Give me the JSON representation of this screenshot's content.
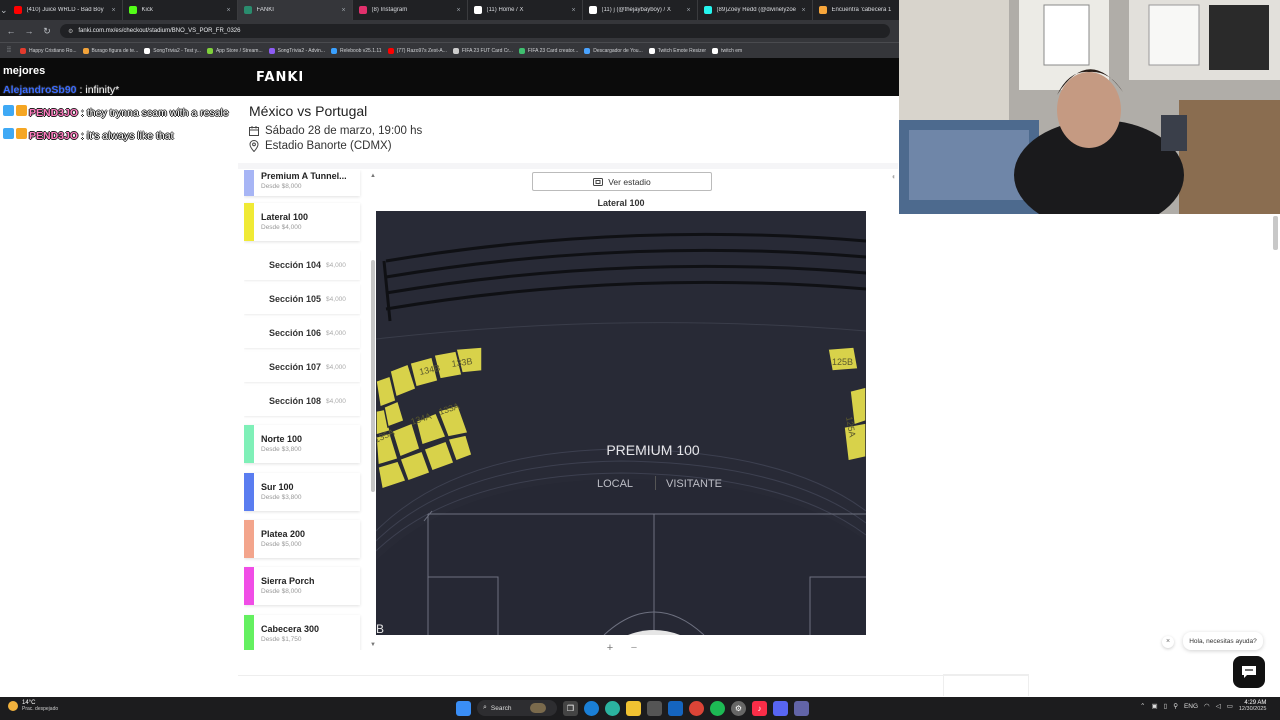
{
  "browser": {
    "tabs": [
      {
        "label": "(410) Juice WRLD - Bad Boy",
        "favicon_color": "#ff0000"
      },
      {
        "label": "Kick",
        "favicon_color": "#53fc18"
      },
      {
        "label": "FANKI",
        "favicon_color": "#2a8c6e"
      },
      {
        "label": "(8) Instagram",
        "favicon_color": "#e1306c"
      },
      {
        "label": "(11) Home / X",
        "favicon_color": "#ffffff"
      },
      {
        "label": "(11) j (@thejaybayboy) / X",
        "favicon_color": "#ffffff"
      },
      {
        "label": "(89)Zoey Redd (@divinelyzoey)",
        "favicon_color": "#25f4ee"
      },
      {
        "label": "Encuentra 'cabecera 1",
        "favicon_color": "#f7a63b"
      }
    ],
    "url": "fanki.com.mx/es/checkout/stadium/BNO_VS_POR_FR_0326",
    "bookmarks": [
      {
        "label": "Happy Cristiano Ro...",
        "color": "#e33b2e"
      },
      {
        "label": "Burago figura de te...",
        "color": "#f2a33a"
      },
      {
        "label": "SongTrivia2 - Test y...",
        "color": "#ffffff"
      },
      {
        "label": "App Store / Stream...",
        "color": "#7fd13b"
      },
      {
        "label": "SongTrivia2 - Advin...",
        "color": "#8e5cf5"
      },
      {
        "label": "Releboob v25.1.11",
        "color": "#3aa0ff"
      },
      {
        "label": "(77) Razo97s Zest-A...",
        "color": "#ff0000"
      },
      {
        "label": "FIFA 23 FUT Card Cr...",
        "color": "#cccccc"
      },
      {
        "label": "FIFA 23 Card creator...",
        "color": "#3fbf6f"
      },
      {
        "label": "Descargador de You...",
        "color": "#4aa3ff"
      },
      {
        "label": "Twitch Emote Resizer",
        "color": "#ffffff"
      },
      {
        "label": "twitch em",
        "color": "#ffffff"
      }
    ]
  },
  "site": {
    "logo": "FANKI"
  },
  "chat": {
    "header": "mejores",
    "messages": [
      {
        "user": "AlejandroSb90",
        "text": ": infinity*",
        "color": "#3b6cff",
        "badges": []
      },
      {
        "user": "PEND3JO",
        "text": ": they trynna scam with a resale",
        "color": "#ff7dc0",
        "badges": [
          "#3fa9f5",
          "#f5a623"
        ]
      },
      {
        "user": "PEND3JO",
        "text": ": it's always like that",
        "color": "#ff7dc0",
        "badges": [
          "#3fa9f5",
          "#f5a623"
        ]
      }
    ]
  },
  "event": {
    "title": "México vs Portugal",
    "date": "Sábado 28 de marzo, 19:00 hs",
    "venue": "Estadio Banorte (CDMX)"
  },
  "sections": {
    "main": [
      {
        "name": "Premium A Tunnel...",
        "price": "Desde $8,000",
        "color": "#a7b5f5"
      },
      {
        "name": "Lateral 100",
        "price": "Desde $4,000",
        "color": "#f0ea35"
      },
      {
        "name": "Norte 100",
        "price": "Desde $3,800",
        "color": "#7ff0b8"
      },
      {
        "name": "Sur 100",
        "price": "Desde $3,800",
        "color": "#5a7df0"
      },
      {
        "name": "Platea 200",
        "price": "Desde $5,000",
        "color": "#f3a58c"
      },
      {
        "name": "Sierra Porch",
        "price": "Desde $8,000",
        "color": "#f04de6"
      },
      {
        "name": "Cabecera 300",
        "price": "Desde $1,750",
        "color": "#64f060"
      }
    ],
    "sub": [
      {
        "name": "Sección 104",
        "price": "$4,000"
      },
      {
        "name": "Sección 105",
        "price": "$4,000"
      },
      {
        "name": "Sección 106",
        "price": "$4,000"
      },
      {
        "name": "Sección 107",
        "price": "$4,000"
      },
      {
        "name": "Sección 108",
        "price": "$4,000"
      }
    ]
  },
  "map": {
    "ver_estadio": "Ver estadio",
    "title": "Lateral 100",
    "premium_label": "PREMIUM 100",
    "local_label": "LOCAL",
    "visitante_label": "VISITANTE",
    "seat_labels": [
      "134B",
      "133B",
      "134A",
      "133A",
      "135A",
      "125B",
      "125A"
    ],
    "zoom_in": "+",
    "zoom_out": "−"
  },
  "help": {
    "bubble": "Hola, necesitas ayuda?",
    "close": "×"
  },
  "taskbar": {
    "weather_temp": "14°C",
    "weather_desc": "Prac. despejado",
    "search": "Search",
    "lang": "ENG",
    "time": "4:29 AM",
    "date": "12/30/2025"
  }
}
